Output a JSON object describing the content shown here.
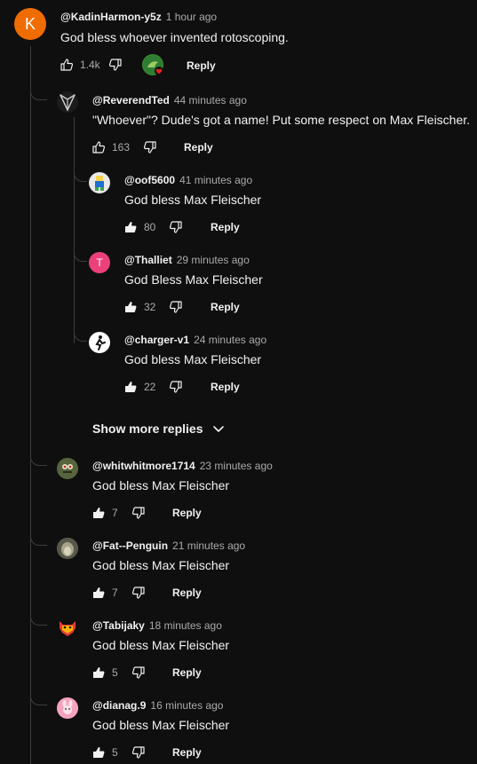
{
  "top": {
    "avatar_letter": "K",
    "handle": "@KadinHarmon-y5z",
    "time": "1 hour ago",
    "text": "God bless whoever invented rotoscoping.",
    "likes": "1.4k",
    "reply": "Reply"
  },
  "r1": {
    "handle": "@ReverendTed",
    "time": "44 minutes ago",
    "text": "\"Whoever\"?  Dude's got a name!  Put some respect on Max Fleischer.",
    "likes": "163",
    "reply": "Reply"
  },
  "r2": {
    "handle": "@oof5600",
    "time": "41 minutes ago",
    "text": "God bless Max Fleischer",
    "likes": "80",
    "reply": "Reply"
  },
  "r3": {
    "avatar_letter": "T",
    "handle": "@Thalliet",
    "time": "29 minutes ago",
    "text": "God Bless Max Fleischer",
    "likes": "32",
    "reply": "Reply"
  },
  "r4": {
    "handle": "@charger-v1",
    "time": "24 minutes ago",
    "text": "God bless Max Fleischer",
    "likes": "22",
    "reply": "Reply"
  },
  "show_more": "Show more replies",
  "r5": {
    "handle": "@whitwhitmore1714",
    "time": "23 minutes ago",
    "text": "God bless Max Fleischer",
    "likes": "7",
    "reply": "Reply"
  },
  "r6": {
    "handle": "@Fat--Penguin",
    "time": "21 minutes ago",
    "text": "God bless Max Fleischer",
    "likes": "7",
    "reply": "Reply"
  },
  "r7": {
    "handle": "@Tabijaky",
    "time": "18 minutes ago",
    "text": "God bless Max Fleischer",
    "likes": "5",
    "reply": "Reply"
  },
  "r8": {
    "handle": "@dianag.9",
    "time": "16 minutes ago",
    "text": "God bless Max Fleischer",
    "likes": "5",
    "reply": "Reply"
  },
  "colors": {
    "bg": "#0f0f0f",
    "text": "#f1f1f1",
    "muted": "#aaaaaa",
    "avatar_k": "#ef6c00",
    "avatar_t": "#ec407a",
    "heart": "#e62117",
    "thread": "#3d3d3d"
  }
}
